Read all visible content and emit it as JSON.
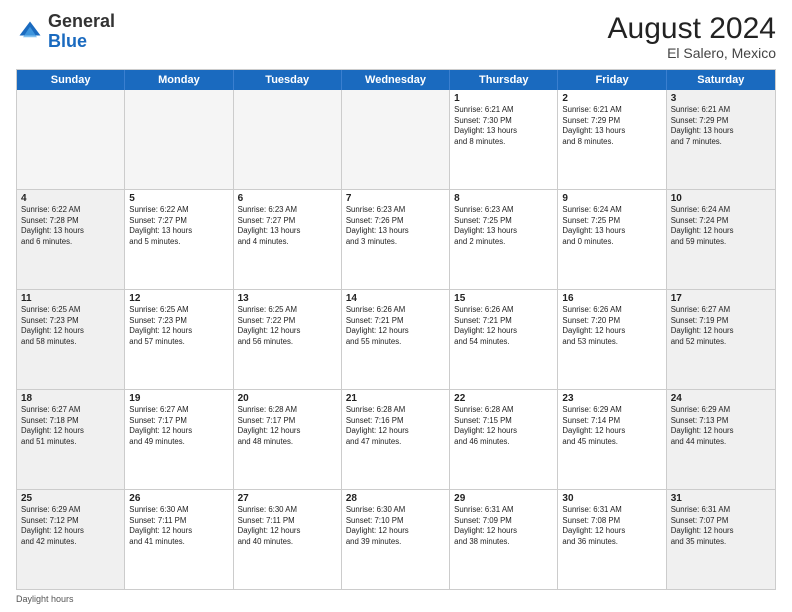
{
  "header": {
    "logo_general": "General",
    "logo_blue": "Blue",
    "month_year": "August 2024",
    "location": "El Salero, Mexico"
  },
  "days_of_week": [
    "Sunday",
    "Monday",
    "Tuesday",
    "Wednesday",
    "Thursday",
    "Friday",
    "Saturday"
  ],
  "footer_label": "Daylight hours",
  "weeks": [
    [
      {
        "day": "",
        "empty": true
      },
      {
        "day": "",
        "empty": true
      },
      {
        "day": "",
        "empty": true
      },
      {
        "day": "",
        "empty": true
      },
      {
        "day": "1",
        "info": "Sunrise: 6:21 AM\nSunset: 7:30 PM\nDaylight: 13 hours\nand 8 minutes."
      },
      {
        "day": "2",
        "info": "Sunrise: 6:21 AM\nSunset: 7:29 PM\nDaylight: 13 hours\nand 8 minutes."
      },
      {
        "day": "3",
        "info": "Sunrise: 6:21 AM\nSunset: 7:29 PM\nDaylight: 13 hours\nand 7 minutes."
      }
    ],
    [
      {
        "day": "4",
        "info": "Sunrise: 6:22 AM\nSunset: 7:28 PM\nDaylight: 13 hours\nand 6 minutes."
      },
      {
        "day": "5",
        "info": "Sunrise: 6:22 AM\nSunset: 7:27 PM\nDaylight: 13 hours\nand 5 minutes."
      },
      {
        "day": "6",
        "info": "Sunrise: 6:23 AM\nSunset: 7:27 PM\nDaylight: 13 hours\nand 4 minutes."
      },
      {
        "day": "7",
        "info": "Sunrise: 6:23 AM\nSunset: 7:26 PM\nDaylight: 13 hours\nand 3 minutes."
      },
      {
        "day": "8",
        "info": "Sunrise: 6:23 AM\nSunset: 7:25 PM\nDaylight: 13 hours\nand 2 minutes."
      },
      {
        "day": "9",
        "info": "Sunrise: 6:24 AM\nSunset: 7:25 PM\nDaylight: 13 hours\nand 0 minutes."
      },
      {
        "day": "10",
        "info": "Sunrise: 6:24 AM\nSunset: 7:24 PM\nDaylight: 12 hours\nand 59 minutes."
      }
    ],
    [
      {
        "day": "11",
        "info": "Sunrise: 6:25 AM\nSunset: 7:23 PM\nDaylight: 12 hours\nand 58 minutes."
      },
      {
        "day": "12",
        "info": "Sunrise: 6:25 AM\nSunset: 7:23 PM\nDaylight: 12 hours\nand 57 minutes."
      },
      {
        "day": "13",
        "info": "Sunrise: 6:25 AM\nSunset: 7:22 PM\nDaylight: 12 hours\nand 56 minutes."
      },
      {
        "day": "14",
        "info": "Sunrise: 6:26 AM\nSunset: 7:21 PM\nDaylight: 12 hours\nand 55 minutes."
      },
      {
        "day": "15",
        "info": "Sunrise: 6:26 AM\nSunset: 7:21 PM\nDaylight: 12 hours\nand 54 minutes."
      },
      {
        "day": "16",
        "info": "Sunrise: 6:26 AM\nSunset: 7:20 PM\nDaylight: 12 hours\nand 53 minutes."
      },
      {
        "day": "17",
        "info": "Sunrise: 6:27 AM\nSunset: 7:19 PM\nDaylight: 12 hours\nand 52 minutes."
      }
    ],
    [
      {
        "day": "18",
        "info": "Sunrise: 6:27 AM\nSunset: 7:18 PM\nDaylight: 12 hours\nand 51 minutes."
      },
      {
        "day": "19",
        "info": "Sunrise: 6:27 AM\nSunset: 7:17 PM\nDaylight: 12 hours\nand 49 minutes."
      },
      {
        "day": "20",
        "info": "Sunrise: 6:28 AM\nSunset: 7:17 PM\nDaylight: 12 hours\nand 48 minutes."
      },
      {
        "day": "21",
        "info": "Sunrise: 6:28 AM\nSunset: 7:16 PM\nDaylight: 12 hours\nand 47 minutes."
      },
      {
        "day": "22",
        "info": "Sunrise: 6:28 AM\nSunset: 7:15 PM\nDaylight: 12 hours\nand 46 minutes."
      },
      {
        "day": "23",
        "info": "Sunrise: 6:29 AM\nSunset: 7:14 PM\nDaylight: 12 hours\nand 45 minutes."
      },
      {
        "day": "24",
        "info": "Sunrise: 6:29 AM\nSunset: 7:13 PM\nDaylight: 12 hours\nand 44 minutes."
      }
    ],
    [
      {
        "day": "25",
        "info": "Sunrise: 6:29 AM\nSunset: 7:12 PM\nDaylight: 12 hours\nand 42 minutes."
      },
      {
        "day": "26",
        "info": "Sunrise: 6:30 AM\nSunset: 7:11 PM\nDaylight: 12 hours\nand 41 minutes."
      },
      {
        "day": "27",
        "info": "Sunrise: 6:30 AM\nSunset: 7:11 PM\nDaylight: 12 hours\nand 40 minutes."
      },
      {
        "day": "28",
        "info": "Sunrise: 6:30 AM\nSunset: 7:10 PM\nDaylight: 12 hours\nand 39 minutes."
      },
      {
        "day": "29",
        "info": "Sunrise: 6:31 AM\nSunset: 7:09 PM\nDaylight: 12 hours\nand 38 minutes."
      },
      {
        "day": "30",
        "info": "Sunrise: 6:31 AM\nSunset: 7:08 PM\nDaylight: 12 hours\nand 36 minutes."
      },
      {
        "day": "31",
        "info": "Sunrise: 6:31 AM\nSunset: 7:07 PM\nDaylight: 12 hours\nand 35 minutes."
      }
    ]
  ]
}
